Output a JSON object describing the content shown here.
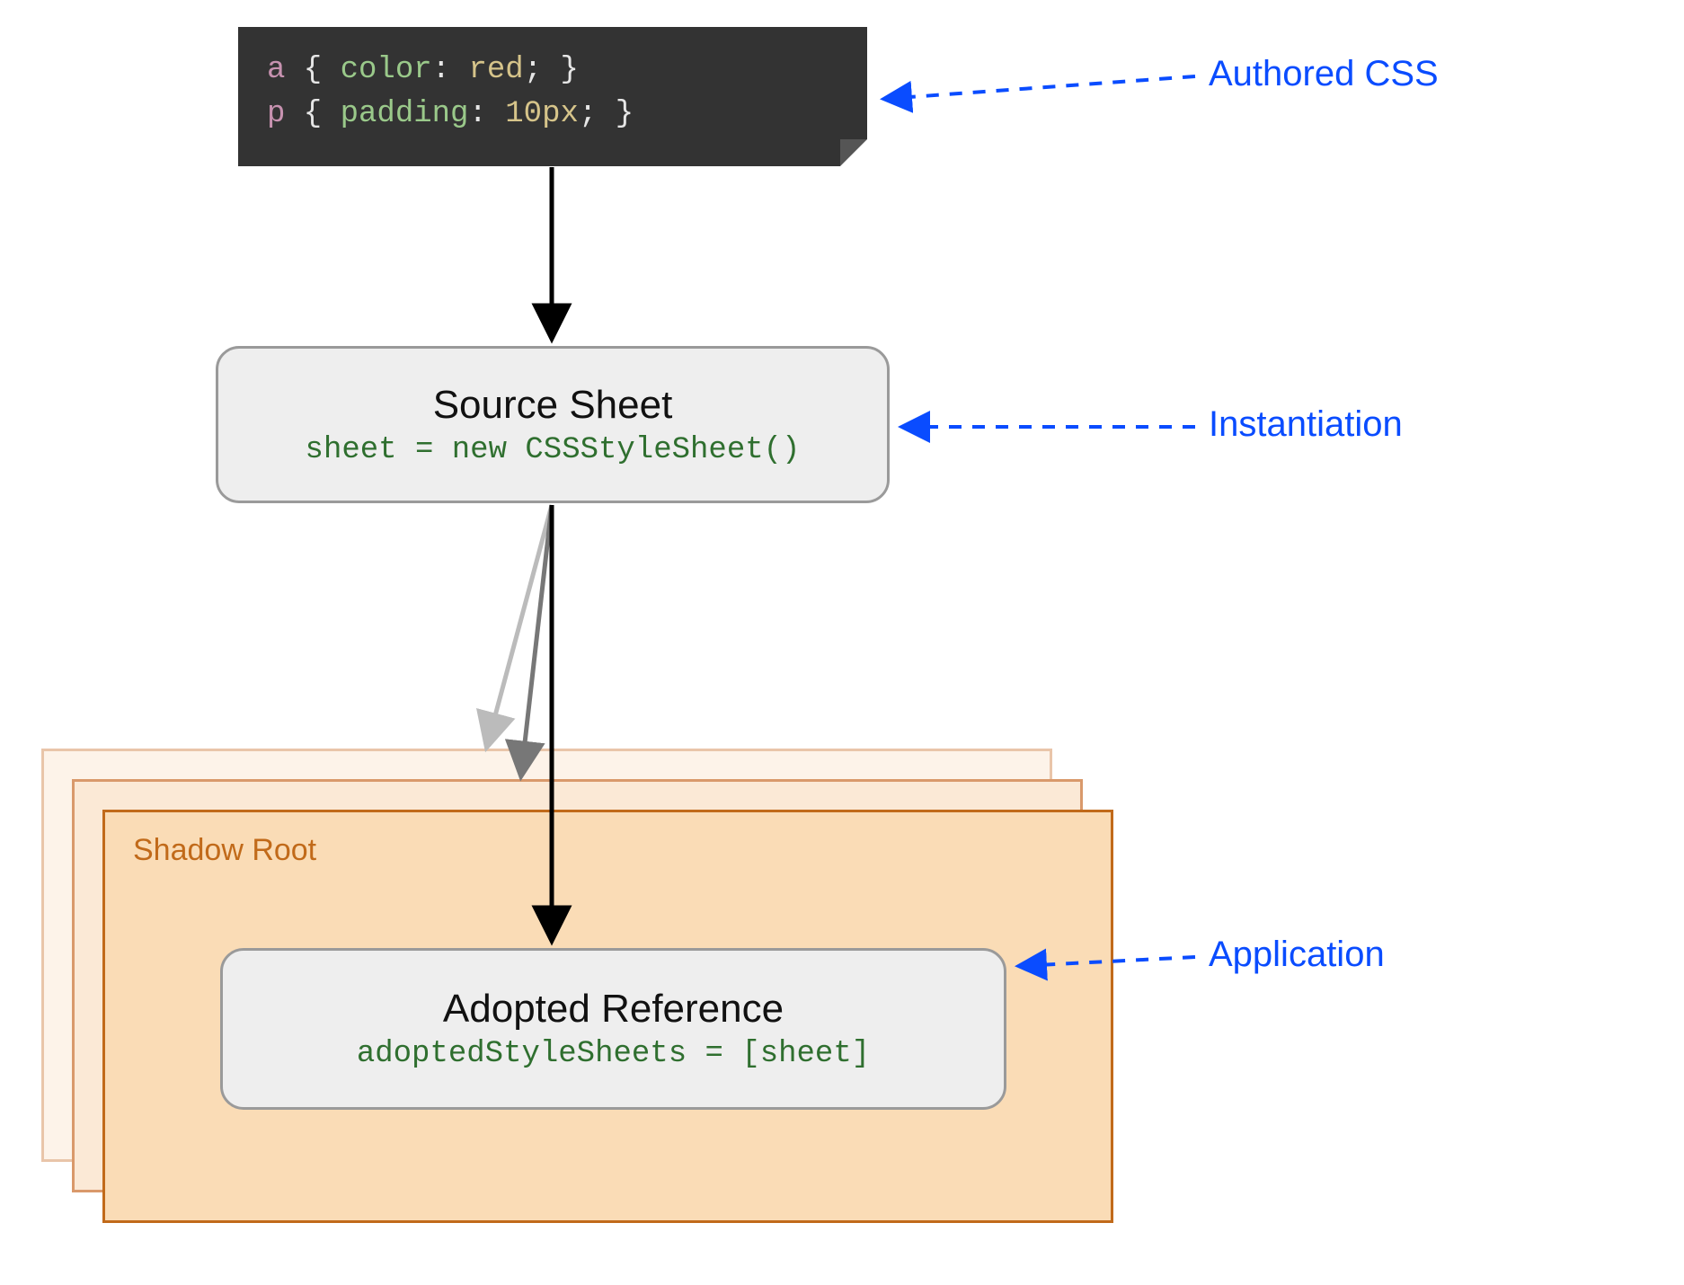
{
  "codebox": {
    "line1": {
      "selector": "a",
      "open": " { ",
      "prop": "color",
      "sep": ": ",
      "value": "red",
      "end": "; }"
    },
    "line2": {
      "selector": "p",
      "open": " { ",
      "prop": "padding",
      "sep": ": ",
      "value": "10px",
      "end": "; }"
    }
  },
  "sourceSheet": {
    "title": "Source Sheet",
    "code": "sheet = new CSSStyleSheet()"
  },
  "shadowRoot": {
    "label": "Shadow Root"
  },
  "adoptedRef": {
    "title": "Adopted Reference",
    "code": "adoptedStyleSheets = [sheet]"
  },
  "annotations": {
    "authored": "Authored CSS",
    "instantiation": "Instantiation",
    "application": "Application"
  },
  "colors": {
    "annotation": "#0a4cff",
    "codeboxBg": "#333333",
    "shadowBorder1": "#c16a1a",
    "shadowFill1": "#fadcb6",
    "shadowBorder2": "#d9996b",
    "shadowFill2": "#fbe9d6",
    "shadowBorder3": "#e9c5a9",
    "shadowFill3": "#fdf3e9"
  }
}
